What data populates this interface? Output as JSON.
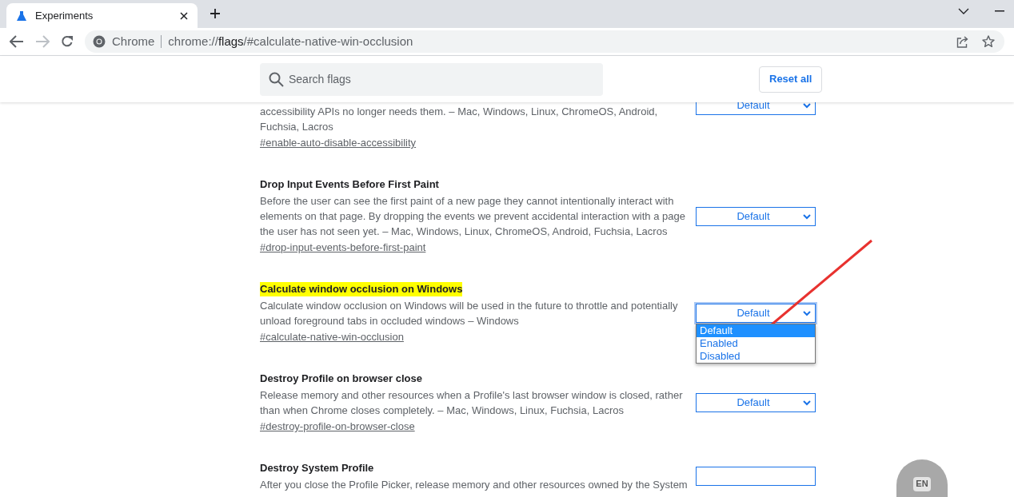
{
  "tabs": [
    {
      "title": "Experiments",
      "selected": true
    }
  ],
  "toolbar": {
    "site_label": "Chrome",
    "url": {
      "scheme": "chrome://",
      "host": "flags",
      "rest": "/#calculate-native-win-occlusion"
    }
  },
  "header": {
    "search": {
      "placeholder": "Search flags"
    },
    "reset_button": "Reset all"
  },
  "flags": [
    {
      "description": "accessibility APIs no longer needs them. – Mac, Windows, Linux, ChromeOS, Android, Fuchsia, Lacros",
      "link": "#enable-auto-disable-accessibility",
      "select": {
        "value": "Default",
        "open": false
      }
    },
    {
      "title": "Drop Input Events Before First Paint",
      "highlighted": false,
      "description": "Before the user can see the first paint of a new page they cannot intentionally interact with elements on that page. By dropping the events we prevent accidental interaction with a page the user has not seen yet. – Mac, Windows, Linux, ChromeOS, Android, Fuchsia, Lacros",
      "link": "#drop-input-events-before-first-paint",
      "select": {
        "value": "Default",
        "open": false
      }
    },
    {
      "title": "Calculate window occlusion on Windows",
      "highlighted": true,
      "description": "Calculate window occlusion on Windows will be used in the future to throttle and potentially unload foreground tabs in occluded windows – Windows",
      "link": "#calculate-native-win-occlusion",
      "select": {
        "value": "Default",
        "open": true,
        "options": [
          {
            "label": "Default",
            "selected": true
          },
          {
            "label": "Enabled",
            "selected": false
          },
          {
            "label": "Disabled",
            "selected": false
          }
        ]
      }
    },
    {
      "title": "Destroy Profile on browser close",
      "highlighted": false,
      "description": "Release memory and other resources when a Profile's last browser window is closed, rather than when Chrome closes completely. – Mac, Windows, Linux, Fuchsia, Lacros",
      "link": "#destroy-profile-on-browser-close",
      "select": {
        "value": "Default",
        "open": false
      }
    },
    {
      "title": "Destroy System Profile",
      "highlighted": false,
      "description": "After you close the Profile Picker, release memory and other resources owned by the System",
      "select": {
        "open": false
      }
    }
  ],
  "language_badge": "EN"
}
